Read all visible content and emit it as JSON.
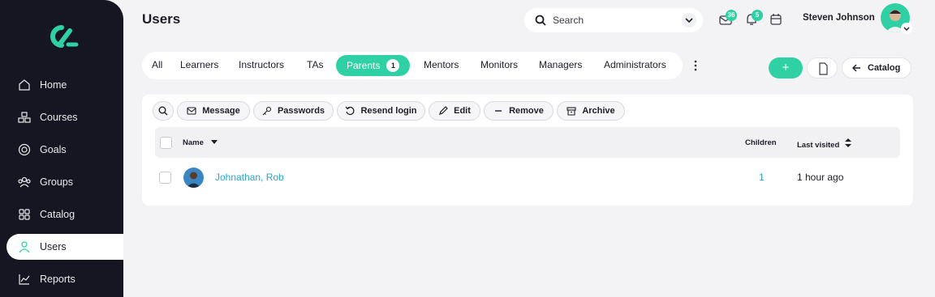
{
  "sidebar": {
    "logo": "logo-mark",
    "items": [
      {
        "label": "Home",
        "icon": "home-icon"
      },
      {
        "label": "Courses",
        "icon": "courses-icon"
      },
      {
        "label": "Goals",
        "icon": "goals-icon"
      },
      {
        "label": "Groups",
        "icon": "groups-icon"
      },
      {
        "label": "Catalog",
        "icon": "catalog-icon"
      },
      {
        "label": "Users",
        "icon": "users-icon",
        "active": true
      },
      {
        "label": "Reports",
        "icon": "reports-icon"
      }
    ]
  },
  "header": {
    "title": "Users",
    "search_placeholder": "Search",
    "messages_count": "36",
    "notifications_count": "5",
    "user_name": "Steven Johnson"
  },
  "tabs": {
    "items": [
      "All",
      "Learners",
      "Instructors",
      "TAs",
      "Parents",
      "Mentors",
      "Monitors",
      "Managers",
      "Administrators"
    ],
    "active": "Parents",
    "active_count": "1"
  },
  "toolbar": {
    "add_label": "+",
    "catalog_label": "Catalog"
  },
  "actions": {
    "message": "Message",
    "passwords": "Passwords",
    "resend_login": "Resend login",
    "edit": "Edit",
    "remove": "Remove",
    "archive": "Archive"
  },
  "table": {
    "columns": {
      "name": "Name",
      "children": "Children",
      "last_visited": "Last visited"
    },
    "rows": [
      {
        "name": "Johnathan, Rob",
        "children": "1",
        "last_visited": "1 hour ago"
      }
    ]
  },
  "colors": {
    "accent": "#2fd1a4",
    "sidebar_bg": "#151621",
    "link": "#2aa6c9",
    "background": "#f3f3f5"
  }
}
